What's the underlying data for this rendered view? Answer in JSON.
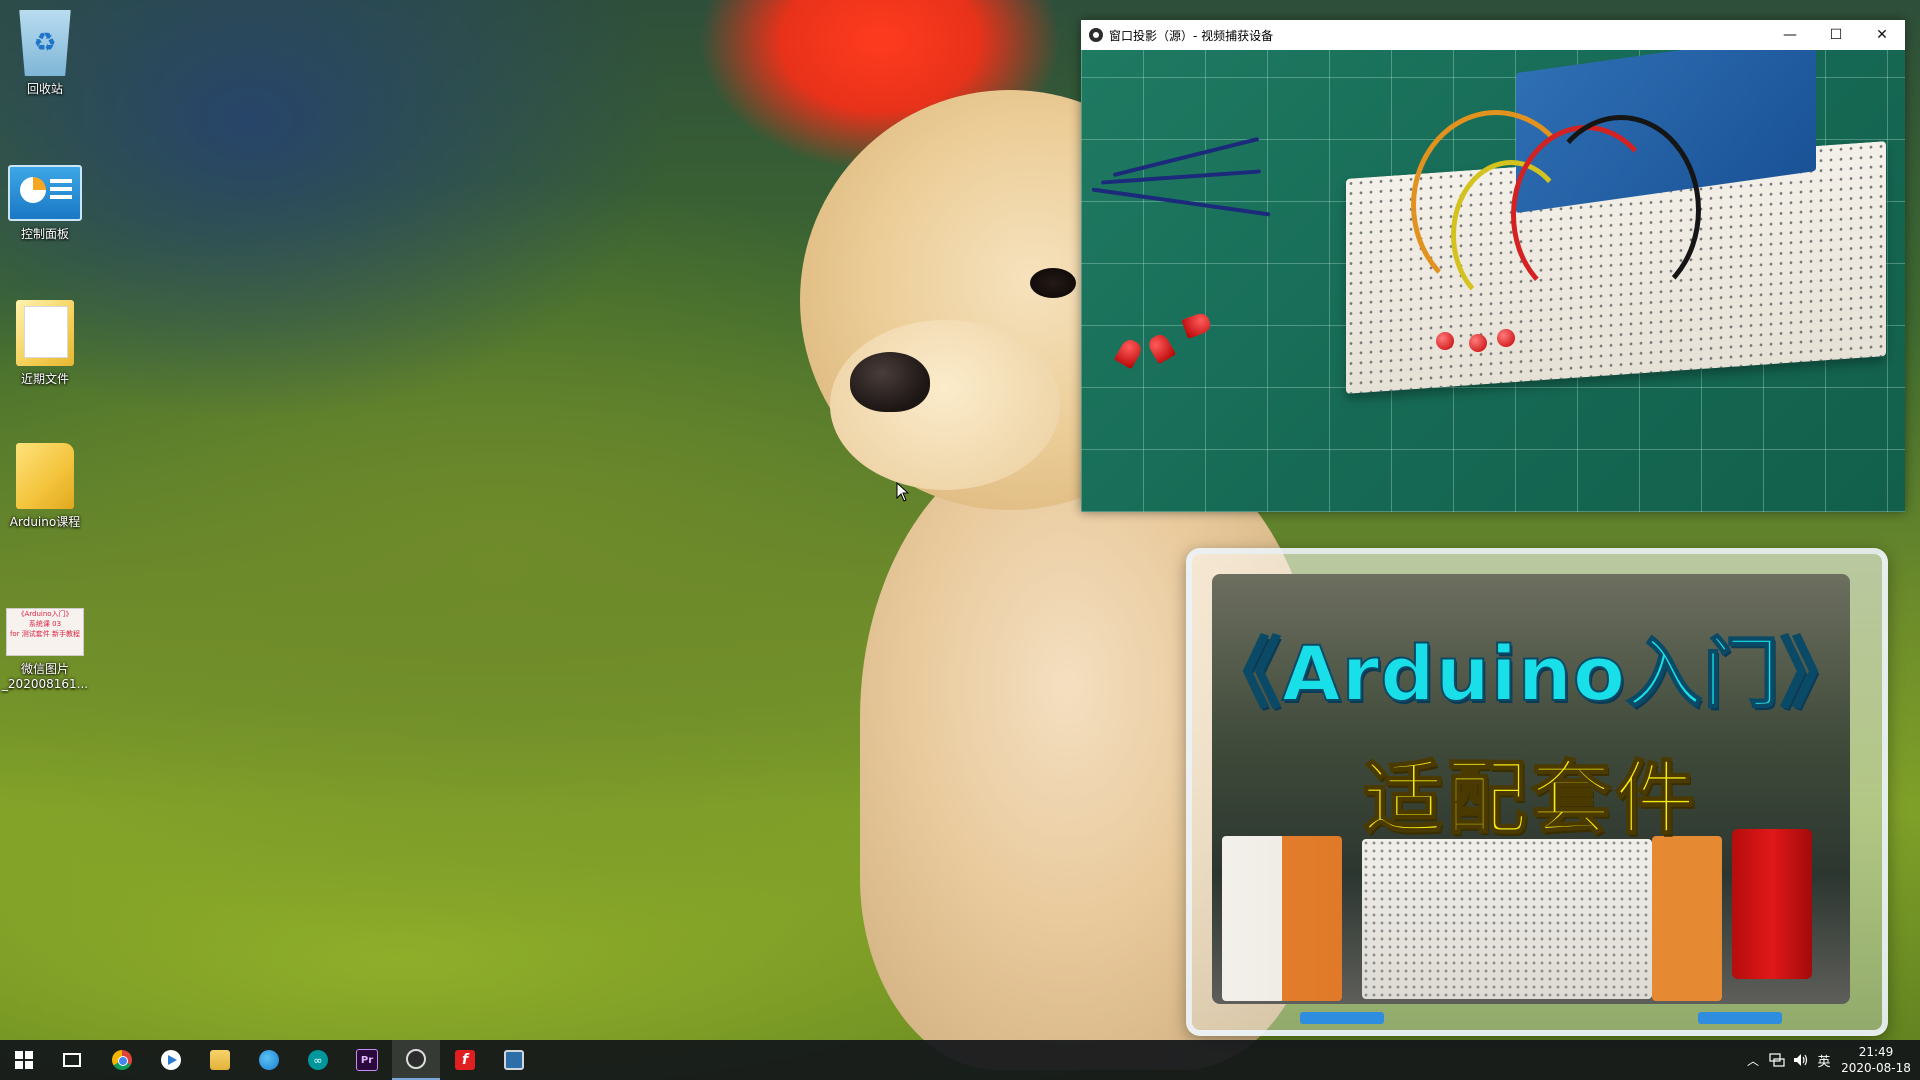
{
  "desktop": {
    "icons": [
      {
        "label": "回收站",
        "icon": "recycle-bin-icon"
      },
      {
        "label": "控制面板",
        "icon": "control-panel-icon"
      },
      {
        "label": "近期文件",
        "icon": "recent-files-folder-icon"
      },
      {
        "label": "Arduino课程",
        "icon": "folder-icon"
      },
      {
        "label_line1": "微信图片",
        "label_line2": "_202008161...",
        "icon": "image-file-icon",
        "thumb_text": [
          "《Arduino入门》",
          "系统课 03",
          "for 测试套件 新手教程"
        ]
      }
    ]
  },
  "video_window": {
    "title": "窗口投影（源）- 视频捕获设备",
    "controls": {
      "minimize": "—",
      "maximize": "☐",
      "close": "✕"
    }
  },
  "promo_image": {
    "title": "《Arduino入门》",
    "subtitle": "适配套件",
    "title_color": "#19e0e8",
    "subtitle_color": "#f7ea12"
  },
  "taskbar": {
    "apps": [
      {
        "name": "start-button",
        "icon": "windows-logo-icon"
      },
      {
        "name": "task-view-button",
        "icon": "task-view-icon"
      },
      {
        "name": "chrome",
        "icon": "chrome-icon"
      },
      {
        "name": "media-player",
        "icon": "play-icon"
      },
      {
        "name": "file-explorer",
        "icon": "file-explorer-icon"
      },
      {
        "name": "edge",
        "icon": "edge-icon"
      },
      {
        "name": "arduino-ide",
        "icon": "arduino-icon",
        "glyph": "∞"
      },
      {
        "name": "premiere-pro",
        "icon": "premiere-icon",
        "glyph": "Pr"
      },
      {
        "name": "obs-studio",
        "icon": "obs-icon"
      },
      {
        "name": "foxit-reader",
        "icon": "foxit-icon",
        "glyph": "f"
      },
      {
        "name": "remote-desktop",
        "icon": "monitor-icon"
      }
    ],
    "active_app": "obs-studio",
    "tray": {
      "ime": "英",
      "time": "21:49",
      "date": "2020-08-18"
    }
  }
}
